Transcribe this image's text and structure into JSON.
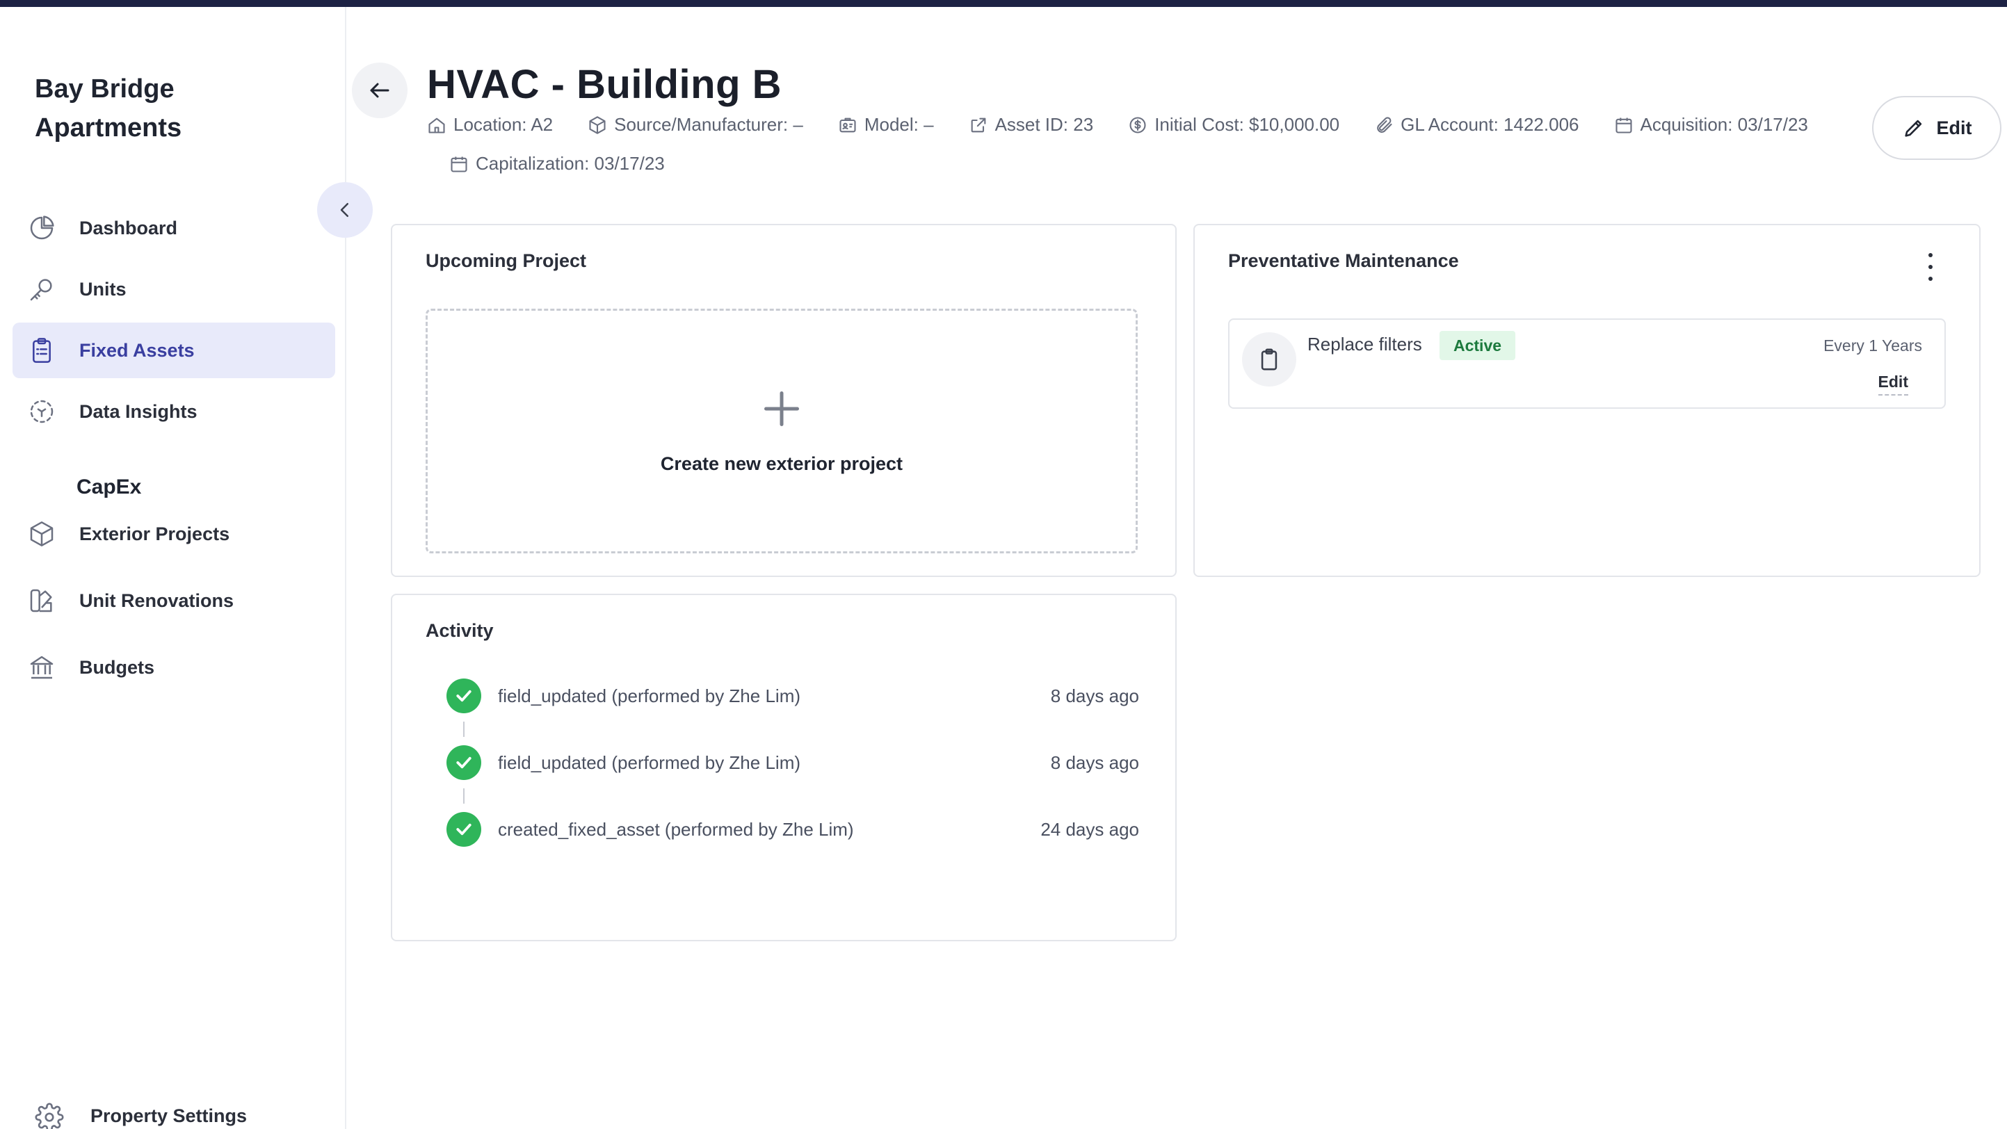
{
  "sidebar": {
    "brand": "Bay Bridge Apartments",
    "items": [
      {
        "label": "Dashboard",
        "icon": "pie-chart-icon"
      },
      {
        "label": "Units",
        "icon": "key-icon"
      },
      {
        "label": "Fixed Assets",
        "icon": "clipboard-icon",
        "active": true
      },
      {
        "label": "Data Insights",
        "icon": "scan-icon"
      }
    ],
    "capex_label": "CapEx",
    "capex_items": [
      {
        "label": "Exterior Projects",
        "icon": "cube-icon"
      },
      {
        "label": "Unit Renovations",
        "icon": "swatch-icon"
      },
      {
        "label": "Budgets",
        "icon": "bank-icon"
      }
    ],
    "settings_label": "Property Settings"
  },
  "header": {
    "title": "HVAC - Building B",
    "meta": {
      "location": "Location: A2",
      "source": "Source/Manufacturer: –",
      "model": "Model: –",
      "asset_id": "Asset ID: 23",
      "initial_cost": "Initial Cost: $10,000.00",
      "gl_account": "GL Account: 1422.006",
      "acquisition": "Acquisition: 03/17/23",
      "capitalization": "Capitalization: 03/17/23"
    },
    "edit_label": "Edit"
  },
  "upcoming_project": {
    "title": "Upcoming Project",
    "create_label": "Create new exterior project"
  },
  "preventative_maintenance": {
    "title": "Preventative Maintenance",
    "items": [
      {
        "name": "Replace filters",
        "status": "Active",
        "frequency": "Every 1 Years",
        "edit_label": "Edit"
      }
    ]
  },
  "activity": {
    "title": "Activity",
    "items": [
      {
        "text": "field_updated (performed by Zhe Lim)",
        "time": "8 days ago"
      },
      {
        "text": "field_updated (performed by Zhe Lim)",
        "time": "8 days ago"
      },
      {
        "text": "created_fixed_asset (performed by Zhe Lim)",
        "time": "24 days ago"
      }
    ]
  },
  "colors": {
    "accent": "#3a3fa0",
    "active_bg": "#e8eafa",
    "success": "#2fb55a",
    "badge_bg": "#e2f7e8",
    "topbar": "#1d2244"
  }
}
